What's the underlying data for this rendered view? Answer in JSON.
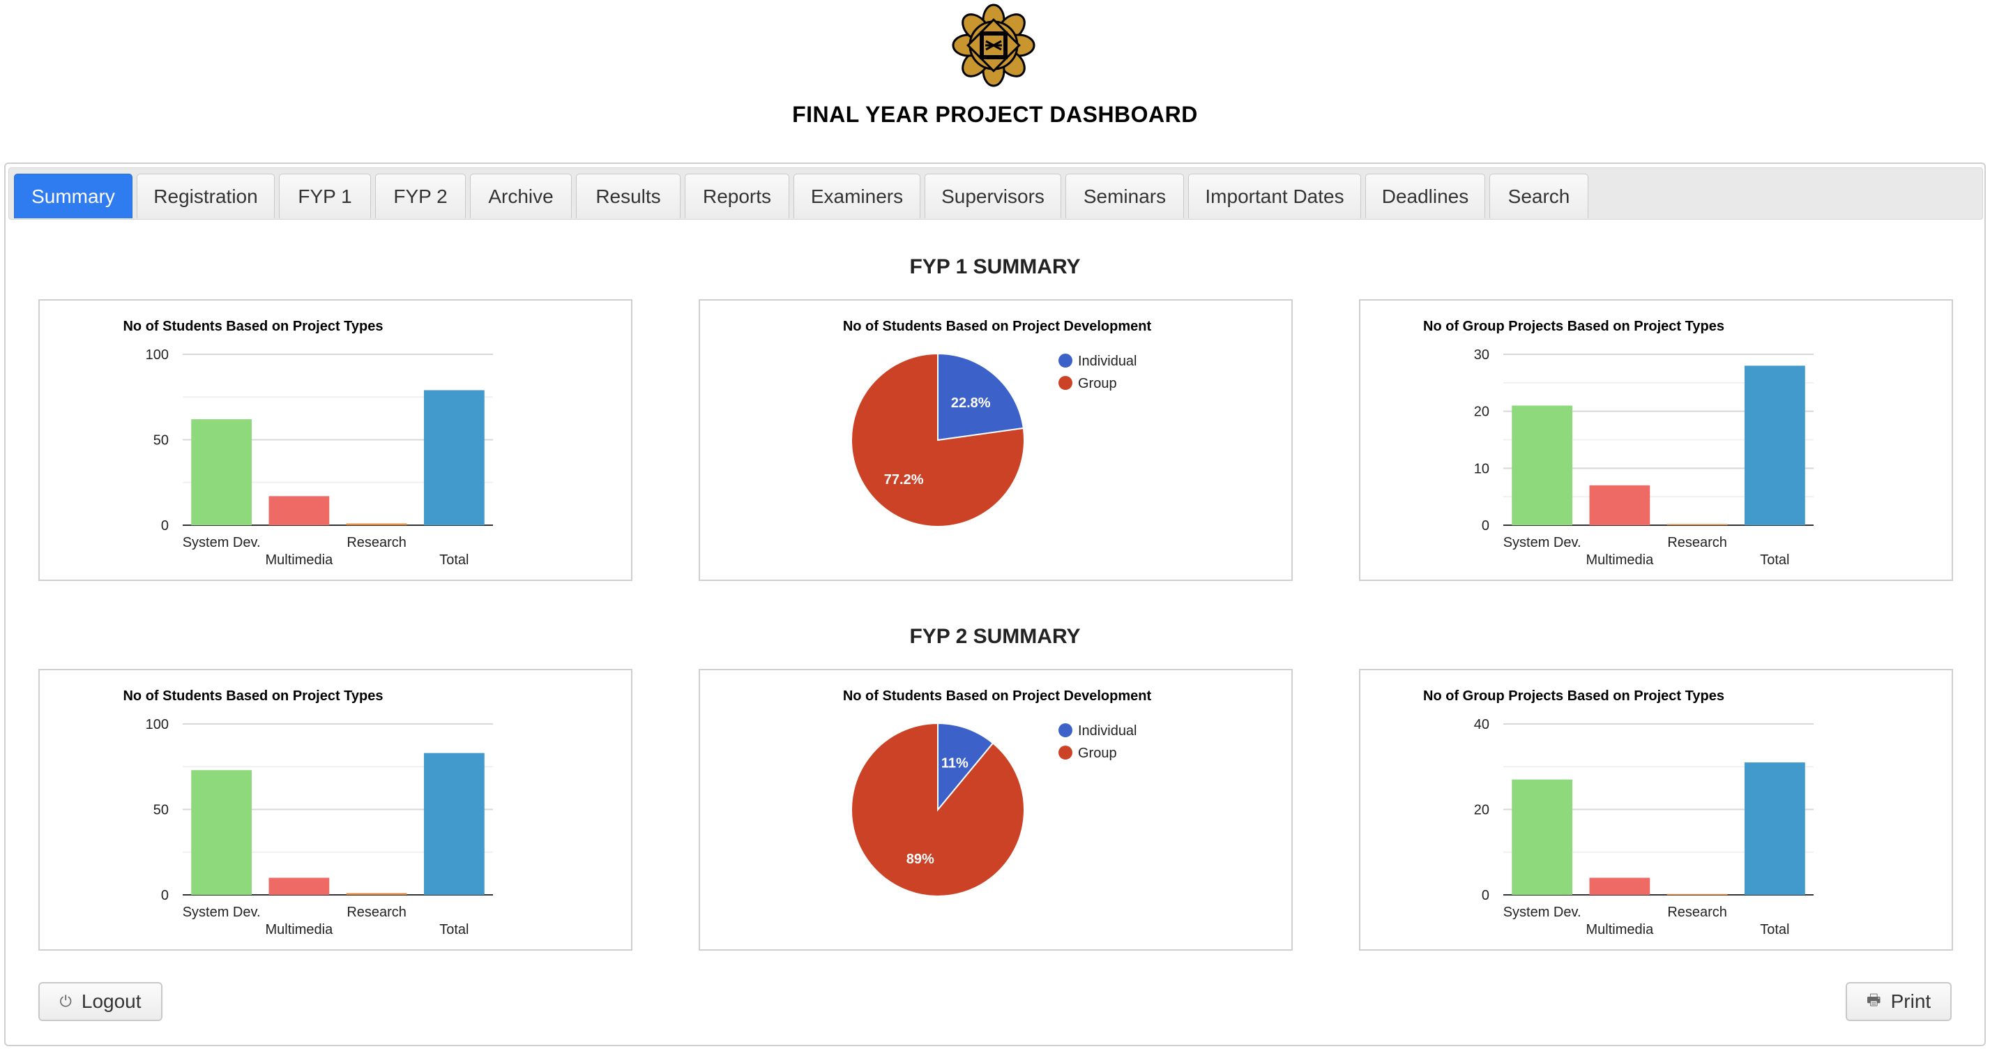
{
  "header": {
    "title": "FINAL YEAR PROJECT DASHBOARD"
  },
  "tabs": [
    "Summary",
    "Registration",
    "FYP 1",
    "FYP 2",
    "Archive",
    "Results",
    "Reports",
    "Examiners",
    "Supervisors",
    "Seminars",
    "Important Dates",
    "Deadlines",
    "Search"
  ],
  "active_tab": "Summary",
  "sections": {
    "fyp1": "FYP 1 SUMMARY",
    "fyp2": "FYP 2 SUMMARY"
  },
  "buttons": {
    "logout": "Logout",
    "print": "Print",
    "logout_icon": "power-icon",
    "print_icon": "printer-icon"
  },
  "colors": {
    "green": "#8fd97d",
    "red": "#ee6b65",
    "orange": "#e58a3c",
    "blue": "#4299cb",
    "pie_blue": "#3c62c9",
    "pie_red": "#cc4226",
    "accent": "#2f7bf0"
  },
  "chart_data": [
    {
      "id": "fyp1-types",
      "type": "bar",
      "title": "No of Students Based on Project Types",
      "categories": [
        "System Dev.",
        "Multimedia",
        "Research",
        "Total"
      ],
      "values": [
        62,
        17,
        1,
        79
      ],
      "ylim": [
        0,
        100
      ],
      "yticks": [
        0,
        50,
        100
      ],
      "grid": true
    },
    {
      "id": "fyp1-dev",
      "type": "pie",
      "title": "No of Students Based on Project Development",
      "labels": [
        "Individual",
        "Group"
      ],
      "values": [
        22.8,
        77.2
      ],
      "value_labels": [
        "22.8%",
        "77.2%"
      ],
      "legend": "top-right"
    },
    {
      "id": "fyp1-groups",
      "type": "bar",
      "title": "No of Group Projects Based on Project Types",
      "categories": [
        "System Dev.",
        "Multimedia",
        "Research",
        "Total"
      ],
      "values": [
        21,
        7,
        0.2,
        28
      ],
      "ylim": [
        0,
        30
      ],
      "yticks": [
        0,
        10,
        20,
        30
      ],
      "grid": true
    },
    {
      "id": "fyp2-types",
      "type": "bar",
      "title": "No of Students Based on Project Types",
      "categories": [
        "System Dev.",
        "Multimedia",
        "Research",
        "Total"
      ],
      "values": [
        73,
        10,
        1,
        83
      ],
      "ylim": [
        0,
        100
      ],
      "yticks": [
        0,
        50,
        100
      ],
      "grid": true
    },
    {
      "id": "fyp2-dev",
      "type": "pie",
      "title": "No of Students Based on Project Development",
      "labels": [
        "Individual",
        "Group"
      ],
      "values": [
        11,
        89
      ],
      "value_labels": [
        "11%",
        "89%"
      ],
      "legend": "top-right"
    },
    {
      "id": "fyp2-groups",
      "type": "bar",
      "title": "No of Group Projects Based on Project Types",
      "categories": [
        "System Dev.",
        "Multimedia",
        "Research",
        "Total"
      ],
      "values": [
        27,
        4,
        0.2,
        31
      ],
      "ylim": [
        0,
        40
      ],
      "yticks": [
        0,
        20,
        40
      ],
      "grid": true
    }
  ]
}
